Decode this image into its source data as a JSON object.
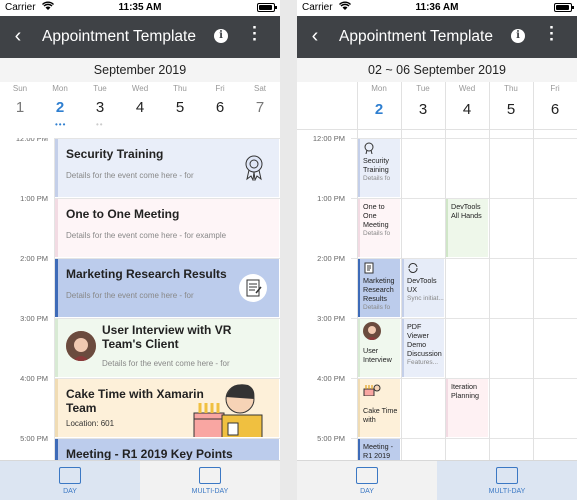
{
  "left": {
    "status": {
      "carrier": "Carrier",
      "time": "11:35 AM"
    },
    "title": "Appointment Template",
    "month": "September 2019",
    "days": [
      {
        "name": "Sun",
        "num": "1"
      },
      {
        "name": "Mon",
        "num": "2"
      },
      {
        "name": "Tue",
        "num": "3"
      },
      {
        "name": "Wed",
        "num": "4"
      },
      {
        "name": "Thu",
        "num": "5"
      },
      {
        "name": "Fri",
        "num": "6"
      },
      {
        "name": "Sat",
        "num": "7"
      }
    ],
    "hours": [
      "12:00 PM",
      "1:00 PM",
      "2:00 PM",
      "3:00 PM",
      "4:00 PM",
      "5:00 PM"
    ],
    "events": [
      {
        "title": "Security Training",
        "detail": "Details for the event come here - for",
        "bg": "#e9eef9",
        "border": "#c4cfe9"
      },
      {
        "title": "One to One Meeting",
        "detail": "Details for the event come here - for example",
        "bg": "#fef5f7",
        "border": "#f2dbe3"
      },
      {
        "title": "Marketing Research Results",
        "detail": "Details for the event come here - for",
        "bg": "#bcccec",
        "border": "#3e6bb8"
      },
      {
        "title": "User Interview with VR Team's Client",
        "detail": "Details for the event come here - for",
        "bg": "#f0f8ee",
        "border": "#d8ead4"
      },
      {
        "title": "Cake Time with Xamarin Team",
        "detail": "Location: 601",
        "bg": "#fdf0d9",
        "border": "#f0dcb4"
      },
      {
        "title": "Meeting - R1 2019 Key Points",
        "detail": "",
        "bg": "#bcccec",
        "border": "#3e6bb8"
      }
    ],
    "tabs": [
      {
        "label": "DAY"
      },
      {
        "label": "MULTI-DAY"
      }
    ]
  },
  "right": {
    "status": {
      "carrier": "Carrier",
      "time": "11:36 AM"
    },
    "title": "Appointment Template",
    "range": "02 ~ 06 September 2019",
    "days": [
      {
        "name": "Mon",
        "num": "2"
      },
      {
        "name": "Tue",
        "num": "3"
      },
      {
        "name": "Wed",
        "num": "4"
      },
      {
        "name": "Thu",
        "num": "5"
      },
      {
        "name": "Fri",
        "num": "6"
      }
    ],
    "hours": [
      "12:00 PM",
      "1:00 PM",
      "2:00 PM",
      "3:00 PM",
      "4:00 PM",
      "5:00 PM"
    ],
    "events": {
      "security": {
        "title": "Security Training",
        "detail": "Details fo"
      },
      "oneToOne": {
        "title": "One to One Meeting",
        "detail": "Details fo"
      },
      "devtools_all": {
        "title": "DevTools All Hands"
      },
      "marketing": {
        "title": "Marketing Research Results",
        "detail": "Details fo"
      },
      "devtools_ux": {
        "title": "DevTools UX",
        "detail": "Sync initiat..."
      },
      "pdf": {
        "title": "PDF Viewer Demo Discussion",
        "detail": "Features..."
      },
      "user_interview": {
        "title": "User Interview"
      },
      "iteration": {
        "title": "Iteration Planning"
      },
      "cake": {
        "title": "Cake Time with"
      },
      "meeting_r1": {
        "title": "Meeting - R1 2019"
      }
    },
    "tabs": [
      {
        "label": "DAY"
      },
      {
        "label": "MULTI-DAY"
      }
    ]
  }
}
